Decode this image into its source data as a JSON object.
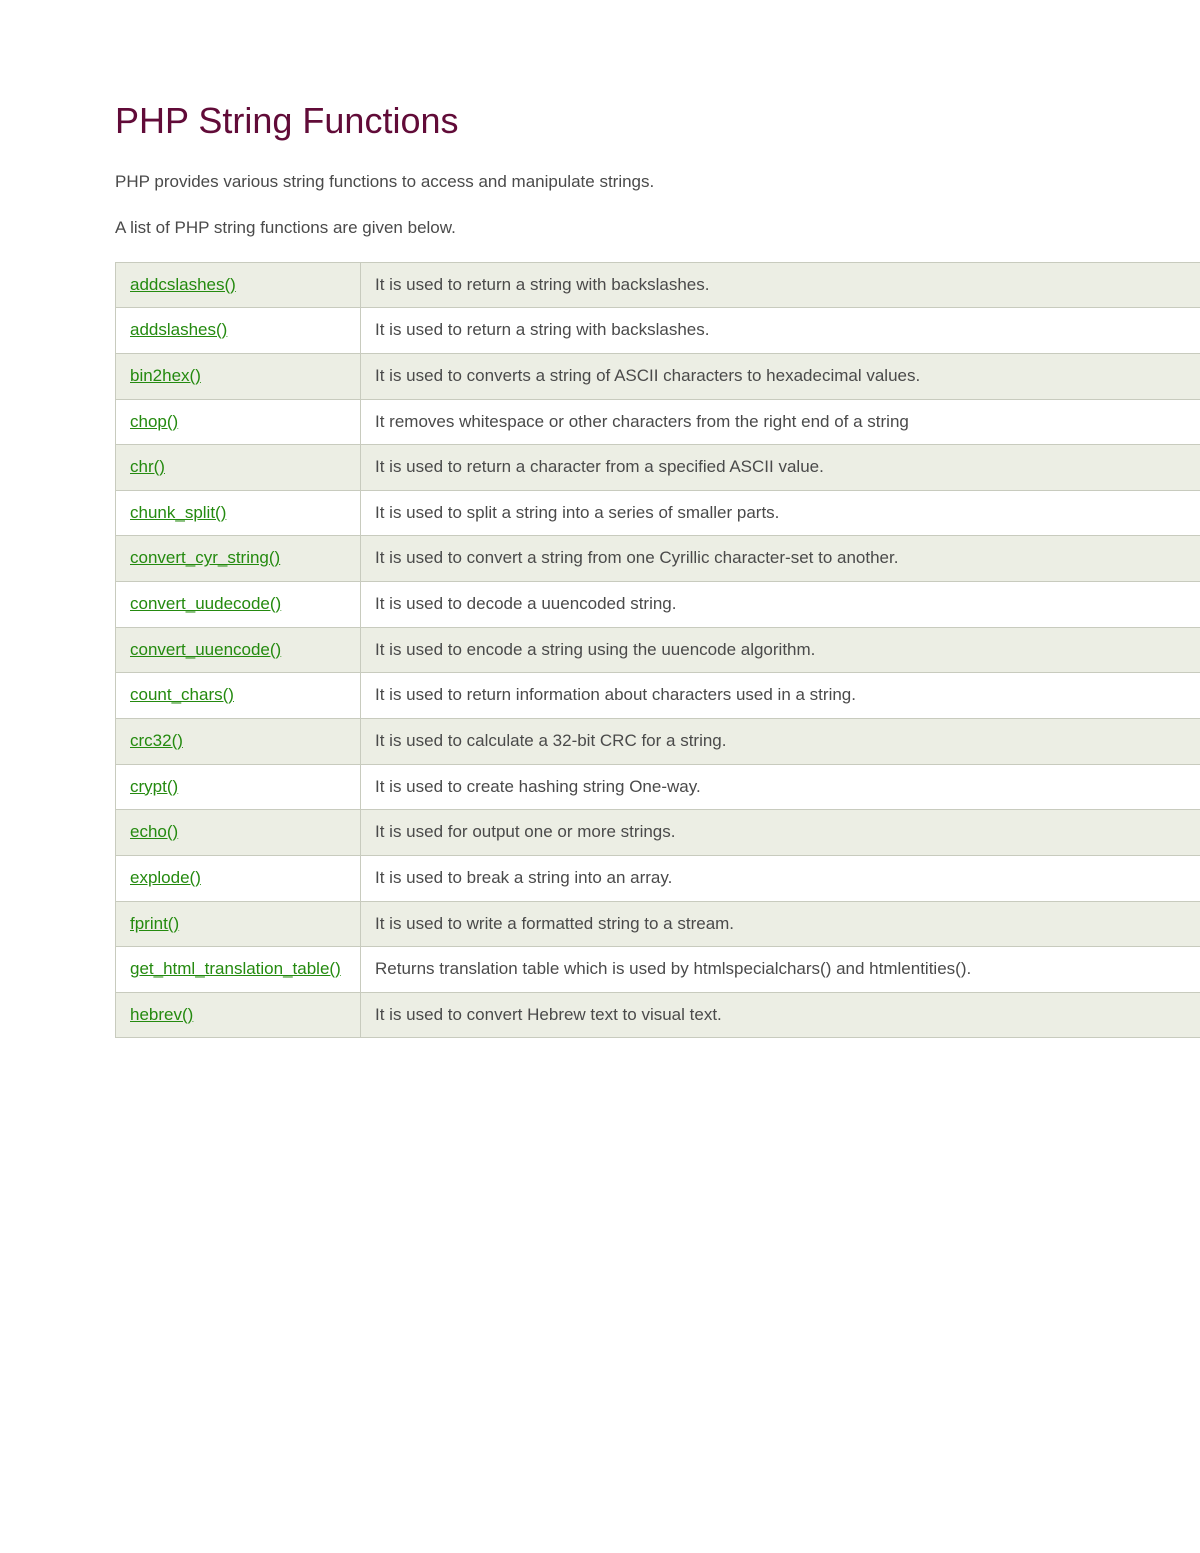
{
  "heading": "PHP String Functions",
  "intro1": "PHP provides various string functions to access and manipulate strings.",
  "intro2": "A list of PHP string functions are given below.",
  "rows": [
    {
      "name": "addcslashes()",
      "desc": "It is used to return a string with backslashes."
    },
    {
      "name": "addslashes()",
      "desc": "It is used to return a string with backslashes."
    },
    {
      "name": "bin2hex()",
      "desc": "It is used to converts a string of ASCII characters to hexadecimal values."
    },
    {
      "name": "chop()",
      "desc": "It removes whitespace or other characters from the right end of a string"
    },
    {
      "name": "chr()",
      "desc": "It is used to return a character from a specified ASCII value."
    },
    {
      "name": "chunk_split()",
      "desc": "It is used to split a string into a series of smaller parts."
    },
    {
      "name": "convert_cyr_string()",
      "desc": "It is used to convert a string from one Cyrillic character-set to another."
    },
    {
      "name": "convert_uudecode()",
      "desc": "It is used to decode a uuencoded string."
    },
    {
      "name": "convert_uuencode()",
      "desc": "It is used to encode a string using the uuencode algorithm."
    },
    {
      "name": "count_chars()",
      "desc": "It is used to return information about characters used in a string."
    },
    {
      "name": "crc32()",
      "desc": "It is used to calculate a 32-bit CRC for a string."
    },
    {
      "name": "crypt()",
      "desc": "It is used to create hashing string One-way."
    },
    {
      "name": "echo()",
      "desc": "It is used for output one or more strings."
    },
    {
      "name": "explode()",
      "desc": "It is used to break a string into an array."
    },
    {
      "name": "fprint()",
      "desc": "It is used to write a formatted string to a stream."
    },
    {
      "name": "get_html_translation_table()",
      "desc": "Returns translation table which is used by htmlspecialchars() and htmlentities()."
    },
    {
      "name": "hebrev()",
      "desc": "It is used to convert Hebrew text to visual text."
    }
  ]
}
